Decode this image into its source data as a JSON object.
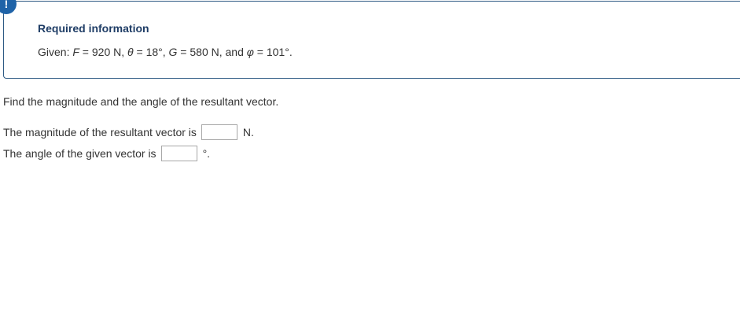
{
  "alert": {
    "icon": "exclamation-icon",
    "glyph": "!",
    "color": "#1f63a8"
  },
  "info": {
    "heading": "Required information",
    "given_prefix": "Given: ",
    "F_sym": "F",
    "F_rest": " = 920 N, ",
    "theta_sym": "θ",
    "theta_rest": " = 18°, ",
    "G_sym": "G",
    "G_rest": " = 580 N, and ",
    "phi_sym": "φ",
    "phi_rest": " = 101°."
  },
  "question": "Find the magnitude and the angle of the resultant vector.",
  "answers": [
    {
      "label": "The magnitude of the resultant vector is",
      "value": "",
      "unit": "N."
    },
    {
      "label": "The angle of the given vector is",
      "value": "",
      "unit": "°."
    }
  ]
}
